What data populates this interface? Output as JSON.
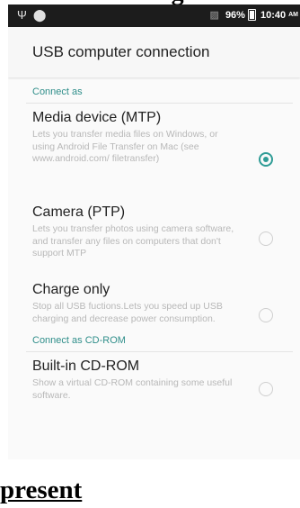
{
  "top_caption": "ng",
  "status_bar": {
    "left_icons": [
      "usb-icon",
      "android-debug-icon"
    ],
    "battery": "96%",
    "time": "10:40",
    "ampm": "AM"
  },
  "header": {
    "title": "USB computer connection"
  },
  "sections": [
    {
      "label": "Connect as",
      "options": [
        {
          "title": "Media device (MTP)",
          "summary": "Lets you transfer media files on Windows, or using Android File Transfer on Mac (see www.android.com/ filetransfer)",
          "checked": true
        },
        {
          "title": "Camera (PTP)",
          "summary": "Lets you transfer photos using camera software, and transfer any files on computers that don't support MTP",
          "checked": false
        },
        {
          "title": "Charge only",
          "summary": "Stop all USB fuctions.Lets you speed up USB charging and decrease power consumption.",
          "checked": false
        }
      ]
    },
    {
      "label": "Connect as CD-ROM",
      "options": [
        {
          "title": "Built-in CD-ROM",
          "summary": "Show a virtual CD-ROM containing some useful software.",
          "checked": false
        }
      ]
    }
  ],
  "bottom_caption": "present",
  "colors": {
    "accent": "#2f9c96",
    "section_label": "#2f8e8a",
    "status_bar": "#1c1c1c"
  }
}
